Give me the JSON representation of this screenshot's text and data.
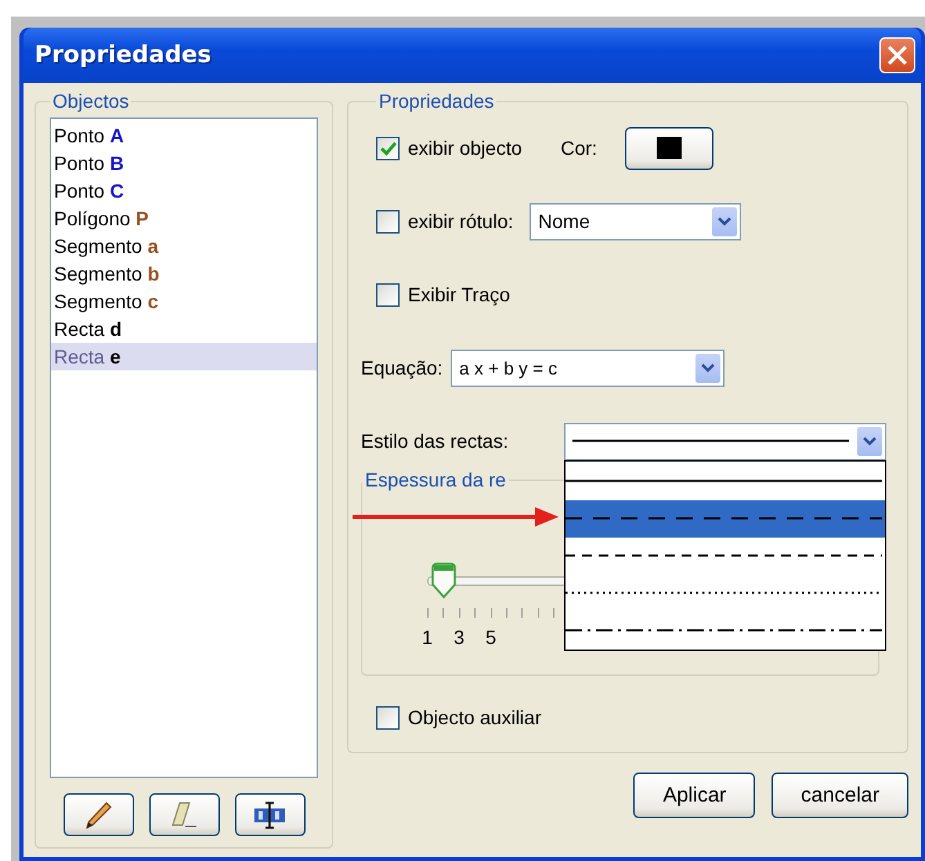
{
  "window": {
    "title": "Propriedades"
  },
  "objects": {
    "title": "Objectos",
    "items": [
      {
        "label": "Ponto",
        "letter": "A",
        "color": "#1515c8",
        "selected": false
      },
      {
        "label": "Ponto",
        "letter": "B",
        "color": "#1515c8",
        "selected": false
      },
      {
        "label": "Ponto",
        "letter": "C",
        "color": "#1515c8",
        "selected": false
      },
      {
        "label": "Polígono",
        "letter": "P",
        "color": "#99501e",
        "selected": false
      },
      {
        "label": "Segmento",
        "letter": "a",
        "color": "#99501e",
        "selected": false
      },
      {
        "label": "Segmento",
        "letter": "b",
        "color": "#99501e",
        "selected": false
      },
      {
        "label": "Segmento",
        "letter": "c",
        "color": "#99501e",
        "selected": false
      },
      {
        "label": "Recta",
        "letter": "d",
        "color": "#000000",
        "selected": false
      },
      {
        "label": "Recta",
        "letter": "e",
        "color": "#000000",
        "selected": true
      }
    ]
  },
  "properties": {
    "title": "Propriedades",
    "show_object": {
      "label": "exibir objecto",
      "checked": true,
      "color_label": "Cor:"
    },
    "show_label": {
      "label": "exibir rótulo:",
      "checked": false,
      "value": "Nome"
    },
    "trace": {
      "label": "Exibir Traço",
      "checked": false
    },
    "equation": {
      "label": "Equação:",
      "value": "a x + b y = c"
    },
    "line_style": {
      "label": "Estilo das rectas:",
      "value": {
        "kind": "solid"
      },
      "options": [
        {
          "kind": "solid",
          "selected": false
        },
        {
          "kind": "long_dash",
          "selected": true
        },
        {
          "kind": "dash",
          "selected": false
        },
        {
          "kind": "dotted",
          "selected": false
        },
        {
          "kind": "dash_dot",
          "selected": false
        }
      ]
    },
    "thickness": {
      "title": "Espessura da re",
      "level": 0.083,
      "tick_labels": [
        "1",
        "3",
        "5"
      ]
    },
    "auxiliary": {
      "label": "Objecto auxiliar",
      "checked": false
    }
  },
  "buttons": [
    "Aplicar",
    "cancelar"
  ]
}
